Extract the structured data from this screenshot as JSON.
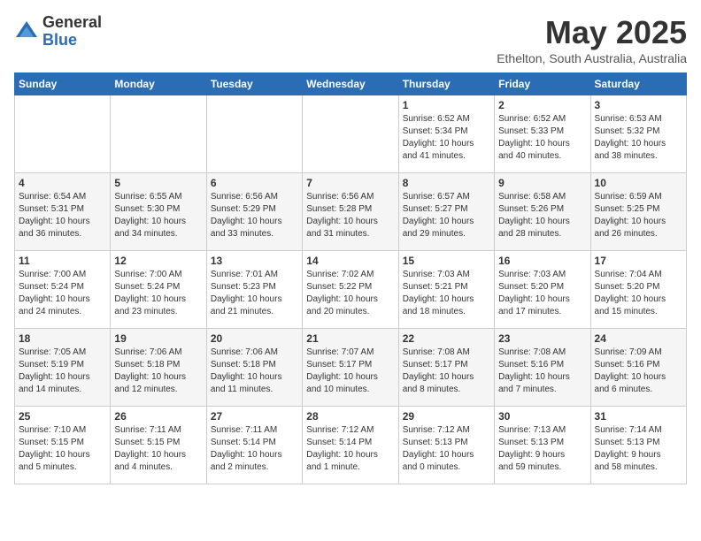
{
  "header": {
    "logo_general": "General",
    "logo_blue": "Blue",
    "month_title": "May 2025",
    "location": "Ethelton, South Australia, Australia"
  },
  "days_of_week": [
    "Sunday",
    "Monday",
    "Tuesday",
    "Wednesday",
    "Thursday",
    "Friday",
    "Saturday"
  ],
  "weeks": [
    [
      {
        "day": "",
        "info": ""
      },
      {
        "day": "",
        "info": ""
      },
      {
        "day": "",
        "info": ""
      },
      {
        "day": "",
        "info": ""
      },
      {
        "day": "1",
        "info": "Sunrise: 6:52 AM\nSunset: 5:34 PM\nDaylight: 10 hours\nand 41 minutes."
      },
      {
        "day": "2",
        "info": "Sunrise: 6:52 AM\nSunset: 5:33 PM\nDaylight: 10 hours\nand 40 minutes."
      },
      {
        "day": "3",
        "info": "Sunrise: 6:53 AM\nSunset: 5:32 PM\nDaylight: 10 hours\nand 38 minutes."
      }
    ],
    [
      {
        "day": "4",
        "info": "Sunrise: 6:54 AM\nSunset: 5:31 PM\nDaylight: 10 hours\nand 36 minutes."
      },
      {
        "day": "5",
        "info": "Sunrise: 6:55 AM\nSunset: 5:30 PM\nDaylight: 10 hours\nand 34 minutes."
      },
      {
        "day": "6",
        "info": "Sunrise: 6:56 AM\nSunset: 5:29 PM\nDaylight: 10 hours\nand 33 minutes."
      },
      {
        "day": "7",
        "info": "Sunrise: 6:56 AM\nSunset: 5:28 PM\nDaylight: 10 hours\nand 31 minutes."
      },
      {
        "day": "8",
        "info": "Sunrise: 6:57 AM\nSunset: 5:27 PM\nDaylight: 10 hours\nand 29 minutes."
      },
      {
        "day": "9",
        "info": "Sunrise: 6:58 AM\nSunset: 5:26 PM\nDaylight: 10 hours\nand 28 minutes."
      },
      {
        "day": "10",
        "info": "Sunrise: 6:59 AM\nSunset: 5:25 PM\nDaylight: 10 hours\nand 26 minutes."
      }
    ],
    [
      {
        "day": "11",
        "info": "Sunrise: 7:00 AM\nSunset: 5:24 PM\nDaylight: 10 hours\nand 24 minutes."
      },
      {
        "day": "12",
        "info": "Sunrise: 7:00 AM\nSunset: 5:24 PM\nDaylight: 10 hours\nand 23 minutes."
      },
      {
        "day": "13",
        "info": "Sunrise: 7:01 AM\nSunset: 5:23 PM\nDaylight: 10 hours\nand 21 minutes."
      },
      {
        "day": "14",
        "info": "Sunrise: 7:02 AM\nSunset: 5:22 PM\nDaylight: 10 hours\nand 20 minutes."
      },
      {
        "day": "15",
        "info": "Sunrise: 7:03 AM\nSunset: 5:21 PM\nDaylight: 10 hours\nand 18 minutes."
      },
      {
        "day": "16",
        "info": "Sunrise: 7:03 AM\nSunset: 5:20 PM\nDaylight: 10 hours\nand 17 minutes."
      },
      {
        "day": "17",
        "info": "Sunrise: 7:04 AM\nSunset: 5:20 PM\nDaylight: 10 hours\nand 15 minutes."
      }
    ],
    [
      {
        "day": "18",
        "info": "Sunrise: 7:05 AM\nSunset: 5:19 PM\nDaylight: 10 hours\nand 14 minutes."
      },
      {
        "day": "19",
        "info": "Sunrise: 7:06 AM\nSunset: 5:18 PM\nDaylight: 10 hours\nand 12 minutes."
      },
      {
        "day": "20",
        "info": "Sunrise: 7:06 AM\nSunset: 5:18 PM\nDaylight: 10 hours\nand 11 minutes."
      },
      {
        "day": "21",
        "info": "Sunrise: 7:07 AM\nSunset: 5:17 PM\nDaylight: 10 hours\nand 10 minutes."
      },
      {
        "day": "22",
        "info": "Sunrise: 7:08 AM\nSunset: 5:17 PM\nDaylight: 10 hours\nand 8 minutes."
      },
      {
        "day": "23",
        "info": "Sunrise: 7:08 AM\nSunset: 5:16 PM\nDaylight: 10 hours\nand 7 minutes."
      },
      {
        "day": "24",
        "info": "Sunrise: 7:09 AM\nSunset: 5:16 PM\nDaylight: 10 hours\nand 6 minutes."
      }
    ],
    [
      {
        "day": "25",
        "info": "Sunrise: 7:10 AM\nSunset: 5:15 PM\nDaylight: 10 hours\nand 5 minutes."
      },
      {
        "day": "26",
        "info": "Sunrise: 7:11 AM\nSunset: 5:15 PM\nDaylight: 10 hours\nand 4 minutes."
      },
      {
        "day": "27",
        "info": "Sunrise: 7:11 AM\nSunset: 5:14 PM\nDaylight: 10 hours\nand 2 minutes."
      },
      {
        "day": "28",
        "info": "Sunrise: 7:12 AM\nSunset: 5:14 PM\nDaylight: 10 hours\nand 1 minute."
      },
      {
        "day": "29",
        "info": "Sunrise: 7:12 AM\nSunset: 5:13 PM\nDaylight: 10 hours\nand 0 minutes."
      },
      {
        "day": "30",
        "info": "Sunrise: 7:13 AM\nSunset: 5:13 PM\nDaylight: 9 hours\nand 59 minutes."
      },
      {
        "day": "31",
        "info": "Sunrise: 7:14 AM\nSunset: 5:13 PM\nDaylight: 9 hours\nand 58 minutes."
      }
    ]
  ]
}
